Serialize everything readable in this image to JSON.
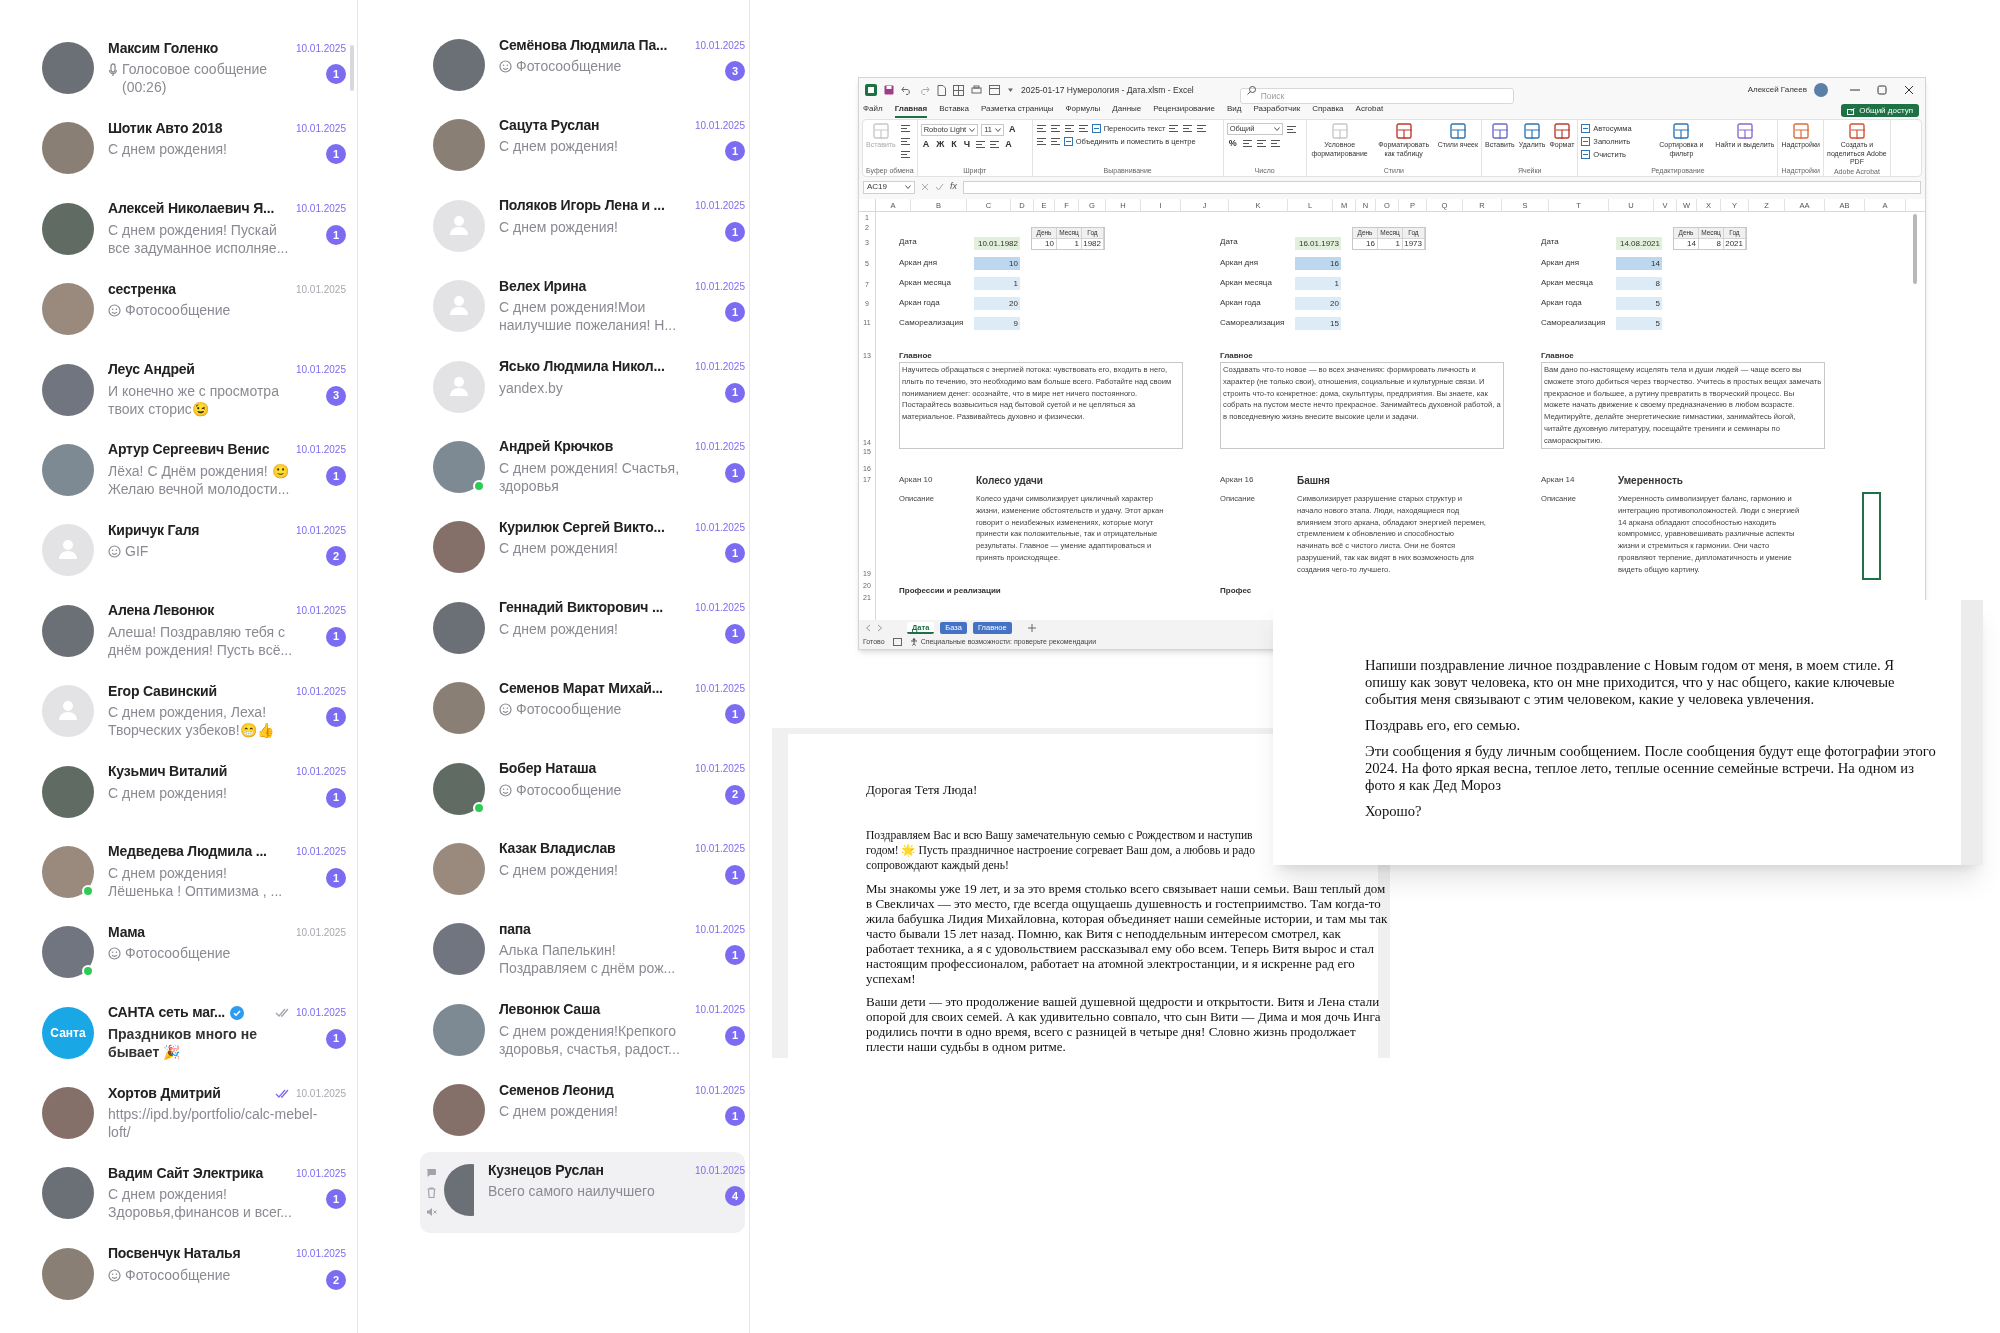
{
  "chats_left": [
    {
      "name": "Максим Голенко",
      "date": "10.01.2025",
      "preview": [
        "Голосовое сообщение",
        "(00:26)"
      ],
      "preview_icon": {
        "kind": "voice"
      },
      "unread": "1",
      "avatar": {
        "kind": "photo"
      },
      "online": false,
      "selected": false
    },
    {
      "name": "Шотик Авто 2018",
      "date": "10.01.2025",
      "preview": [
        "С днем рождения!"
      ],
      "unread": "1",
      "avatar": {
        "kind": "photo"
      },
      "online": false,
      "selected": false
    },
    {
      "name": "Алексей Николаевич Я...",
      "date": "10.01.2025",
      "preview": [
        "С днем рождения! Пускай",
        "все задуманное исполняе..."
      ],
      "unread": "1",
      "avatar": {
        "kind": "photo"
      },
      "online": false,
      "selected": false
    },
    {
      "name": "сестренка",
      "date": "10.01.2025",
      "preview": [
        "Фотосообщение"
      ],
      "preview_icon": {
        "kind": "photo"
      },
      "avatar": {
        "kind": "photo"
      },
      "online": false,
      "selected": false
    },
    {
      "name": "Леус Андрей",
      "date": "10.01.2025",
      "preview": [
        "И конечно же с просмотра",
        "твоих сторис😉"
      ],
      "unread": "3",
      "avatar": {
        "kind": "photo"
      },
      "online": false,
      "selected": false
    },
    {
      "name": "Артур Сергеевич Венис",
      "date": "10.01.2025",
      "preview": [
        "Лёха! С Днём рождения! 🙂",
        "Желаю вечной молодости..."
      ],
      "unread": "1",
      "avatar": {
        "kind": "photo"
      },
      "online": false,
      "selected": false
    },
    {
      "name": "Киричук Галя",
      "date": "10.01.2025",
      "preview": [
        "GIF"
      ],
      "preview_icon": {
        "kind": "photo"
      },
      "unread": "2",
      "avatar": {
        "kind": "default"
      },
      "online": false,
      "selected": false
    },
    {
      "name": "Алена Левонюк",
      "date": "10.01.2025",
      "preview": [
        "Алеша! Поздравляю тебя с",
        "днём рождения! Пусть всё..."
      ],
      "unread": "1",
      "avatar": {
        "kind": "photo"
      },
      "online": false,
      "selected": false
    },
    {
      "name": "Егор Савинский",
      "date": "10.01.2025",
      "preview": [
        "С днем рождения, Леха!",
        "Творческих узбеков!😁👍"
      ],
      "unread": "1",
      "avatar": {
        "kind": "default"
      },
      "online": false,
      "selected": false
    },
    {
      "name": "Кузьмич Виталий",
      "date": "10.01.2025",
      "preview": [
        "С днем рождения!"
      ],
      "unread": "1",
      "avatar": {
        "kind": "photo"
      },
      "online": false,
      "selected": false
    },
    {
      "name": "Медведева Людмила ...",
      "date": "10.01.2025",
      "preview": [
        "С днем рождения!",
        "Лёшенька ! Оптимизма , ..."
      ],
      "unread": "1",
      "avatar": {
        "kind": "photo"
      },
      "online": true,
      "selected": false
    },
    {
      "name": "Мама",
      "date": "10.01.2025",
      "preview": [
        "Фотосообщение"
      ],
      "preview_icon": {
        "kind": "photo"
      },
      "avatar": {
        "kind": "photo"
      },
      "online": true,
      "selected": false
    },
    {
      "name": "САНТА сеть маг...",
      "verified": true,
      "receipt": {
        "kind": "delivered"
      },
      "date": "10.01.2025",
      "preview": [
        "Праздников много не",
        "бывает 🎉"
      ],
      "bold": true,
      "unread": "1",
      "avatar": {
        "kind": "logo",
        "text": "Санта"
      },
      "online": false,
      "selected": false
    },
    {
      "name": "Хортов Дмитрий",
      "receipt": {
        "kind": "read"
      },
      "date": "10.01.2025",
      "preview": [
        "https://ipd.by/portfolio/calc-mebel-",
        "loft/"
      ],
      "avatar": {
        "kind": "photo"
      },
      "online": false,
      "selected": false
    },
    {
      "name": "Вадим Сайт Электрика",
      "date": "10.01.2025",
      "preview": [
        "С днем рождения!",
        "Здоровья,финансов и всег..."
      ],
      "unread": "1",
      "avatar": {
        "kind": "photo"
      },
      "online": false,
      "selected": false
    },
    {
      "name": "Посвенчук Наталья",
      "date": "10.01.2025",
      "preview": [
        "Фотосообщение"
      ],
      "preview_icon": {
        "kind": "photo"
      },
      "unread": "2",
      "avatar": {
        "kind": "photo"
      },
      "online": false,
      "selected": false
    }
  ],
  "chats_middle": [
    {
      "name": "Семёнова Людмила Па...",
      "date": "10.01.2025",
      "preview": [
        "Фотосообщение"
      ],
      "preview_icon": {
        "kind": "photo"
      },
      "unread": "3",
      "avatar": {
        "kind": "photo"
      },
      "online": false,
      "selected": false
    },
    {
      "name": "Сацута Руслан",
      "date": "10.01.2025",
      "preview": [
        "С днем рождения!"
      ],
      "unread": "1",
      "avatar": {
        "kind": "photo"
      },
      "online": false,
      "selected": false
    },
    {
      "name": "Поляков Игорь Лена и ...",
      "date": "10.01.2025",
      "preview": [
        "С днем рождения!"
      ],
      "unread": "1",
      "avatar": {
        "kind": "default"
      },
      "online": false,
      "selected": false
    },
    {
      "name": "Велех Ирина",
      "date": "10.01.2025",
      "preview": [
        "С днем рождения!Мои",
        "наилучшие пожелания! Н..."
      ],
      "unread": "1",
      "avatar": {
        "kind": "default"
      },
      "online": false,
      "selected": false
    },
    {
      "name": "Ясько Людмила Никол...",
      "date": "10.01.2025",
      "preview": [
        "yandex.by"
      ],
      "unread": "1",
      "avatar": {
        "kind": "default"
      },
      "online": false,
      "selected": false
    },
    {
      "name": "Андрей Крючков",
      "date": "10.01.2025",
      "preview": [
        "С днем рождения! Счастья,",
        "здоровья"
      ],
      "unread": "1",
      "avatar": {
        "kind": "photo"
      },
      "online": true,
      "selected": false
    },
    {
      "name": "Курилюк Сергей Викто...",
      "date": "10.01.2025",
      "preview": [
        "С днем рождения!"
      ],
      "unread": "1",
      "avatar": {
        "kind": "photo"
      },
      "online": false,
      "selected": false
    },
    {
      "name": "Геннадий Викторович ...",
      "date": "10.01.2025",
      "preview": [
        "С днем рождения!"
      ],
      "unread": "1",
      "avatar": {
        "kind": "photo"
      },
      "online": false,
      "selected": false
    },
    {
      "name": "Семенов Марат Михай...",
      "date": "10.01.2025",
      "preview": [
        "Фотосообщение"
      ],
      "preview_icon": {
        "kind": "photo"
      },
      "unread": "1",
      "avatar": {
        "kind": "photo"
      },
      "online": false,
      "selected": false
    },
    {
      "name": "Бобер Наташа",
      "date": "10.01.2025",
      "preview": [
        "Фотосообщение"
      ],
      "preview_icon": {
        "kind": "photo"
      },
      "unread": "2",
      "avatar": {
        "kind": "photo"
      },
      "online": true,
      "selected": false
    },
    {
      "name": "Казак Владислав",
      "date": "10.01.2025",
      "preview": [
        "С днем рождения!"
      ],
      "unread": "1",
      "avatar": {
        "kind": "photo"
      },
      "online": false,
      "selected": false
    },
    {
      "name": "папа",
      "date": "10.01.2025",
      "preview": [
        "Алька Папелькин!",
        "Поздравляем с днём рож..."
      ],
      "unread": "1",
      "avatar": {
        "kind": "photo"
      },
      "online": false,
      "selected": false
    },
    {
      "name": "Левонюк Саша",
      "date": "10.01.2025",
      "preview": [
        "С днем рождения!Крепкого",
        "здоровья, счастья, радост..."
      ],
      "unread": "1",
      "avatar": {
        "kind": "photo"
      },
      "online": false,
      "selected": false
    },
    {
      "name": "Семенов Леонид",
      "date": "10.01.2025",
      "preview": [
        "С днем рождения!"
      ],
      "unread": "1",
      "avatar": {
        "kind": "photo"
      },
      "online": false,
      "selected": false
    },
    {
      "name": "Кузнецов Руслан",
      "date": "10.01.2025",
      "preview": [
        "Всего самого наилучшего"
      ],
      "unread": "4",
      "avatar": {
        "kind": "photo"
      },
      "online": false,
      "selected": true
    }
  ],
  "excel": {
    "title": "2025-01-17 Нумерология - Дата.xlsm  -  Excel",
    "search_placeholder": "Поиск",
    "user": "Алексей Галеев",
    "menu": [
      {
        "label": "Файл",
        "selected": false
      },
      {
        "label": "Главная",
        "selected": true
      },
      {
        "label": "Вставка",
        "selected": false
      },
      {
        "label": "Разметка страницы",
        "selected": false
      },
      {
        "label": "Формулы",
        "selected": false
      },
      {
        "label": "Данные",
        "selected": false
      },
      {
        "label": "Рецензирование",
        "selected": false
      },
      {
        "label": "Вид",
        "selected": false
      },
      {
        "label": "Разработчик",
        "selected": false
      },
      {
        "label": "Справка",
        "selected": false
      },
      {
        "label": "Acrobat",
        "selected": false
      }
    ],
    "share_button": "Общий доступ",
    "ribbon": [
      {
        "label": "Буфер обмена",
        "controls": [
          {
            "kind": "big",
            "label": "Вставить",
            "disabled": true
          },
          {
            "kind": "icon"
          },
          {
            "kind": "icon"
          },
          {
            "kind": "icon"
          }
        ]
      },
      {
        "label": "Шрифт",
        "controls": [
          {
            "kind": "field",
            "value": "Roboto Light"
          },
          {
            "kind": "field",
            "value": "11"
          },
          {
            "kind": "glyph",
            "text": "A"
          },
          {
            "kind": "glyph",
            "text": "A"
          },
          {
            "kind": "glyph",
            "text": "Ж"
          },
          {
            "kind": "glyph",
            "text": "К"
          },
          {
            "kind": "glyph",
            "text": "Ч"
          },
          {
            "kind": "icon"
          },
          {
            "kind": "icon"
          },
          {
            "kind": "glyph",
            "text": "A"
          }
        ]
      },
      {
        "label": "Выравнивание",
        "controls": [
          {
            "kind": "icon"
          },
          {
            "kind": "icon"
          },
          {
            "kind": "icon"
          },
          {
            "kind": "icon"
          },
          {
            "kind": "small",
            "label": "Переносить текст"
          },
          {
            "kind": "icon"
          },
          {
            "kind": "icon"
          },
          {
            "kind": "icon"
          },
          {
            "kind": "icon"
          },
          {
            "kind": "icon"
          },
          {
            "kind": "small",
            "label": "Объединить и поместить в центре"
          }
        ]
      },
      {
        "label": "Число",
        "controls": [
          {
            "kind": "field",
            "value": "Общий"
          },
          {
            "kind": "icon"
          },
          {
            "kind": "glyph",
            "text": "%"
          },
          {
            "kind": "icon"
          },
          {
            "kind": "icon"
          },
          {
            "kind": "icon"
          }
        ]
      },
      {
        "label": "Стили",
        "controls": [
          {
            "kind": "big",
            "label": "Условное форматирование"
          },
          {
            "kind": "big",
            "label": "Форматировать как таблицу"
          },
          {
            "kind": "big",
            "label": "Стили ячеек"
          }
        ]
      },
      {
        "label": "Ячейки",
        "controls": [
          {
            "kind": "big",
            "label": "Вставить"
          },
          {
            "kind": "big",
            "label": "Удалить"
          },
          {
            "kind": "big",
            "label": "Формат"
          }
        ]
      },
      {
        "label": "Редактирование",
        "controls": [
          {
            "kind": "small",
            "label": "Автосумма"
          },
          {
            "kind": "small",
            "label": "Заполнить"
          },
          {
            "kind": "small",
            "label": "Очистить"
          },
          {
            "kind": "big",
            "label": "Сортировка и фильтр"
          },
          {
            "kind": "big",
            "label": "Найти и выделить"
          }
        ]
      },
      {
        "label": "Надстройки",
        "controls": [
          {
            "kind": "big",
            "label": "Надстройки"
          }
        ]
      },
      {
        "label": "Adobe Acrobat",
        "controls": [
          {
            "kind": "big",
            "label": "Создать и поделиться Adobe PDF"
          }
        ]
      }
    ],
    "name_box": "AC19",
    "fx": "fx",
    "columns": [
      "A",
      "B",
      "C",
      "D",
      "E",
      "F",
      "G",
      "H",
      "I",
      "J",
      "K",
      "L",
      "M",
      "N",
      "O",
      "P",
      "Q",
      "R",
      "S",
      "T",
      "U",
      "V",
      "W",
      "X",
      "Y",
      "Z",
      "AA",
      "AB",
      "A"
    ],
    "row_numbers": [
      "1",
      "2",
      "3",
      "5",
      "7",
      "9",
      "11",
      "13",
      "14",
      "15",
      "16",
      "17",
      "19",
      "20",
      "21"
    ],
    "blocks": [
      {
        "date_label": "Дата",
        "date": "10.01.1982",
        "dmy_headers": [
          "День",
          "Месяц",
          "Год"
        ],
        "dmy_values": [
          "10",
          "1",
          "1982"
        ],
        "arcana": [
          {
            "label": "Аркан дня",
            "value": "10"
          },
          {
            "label": "Аркан месяца",
            "value": "1"
          },
          {
            "label": "Аркан года",
            "value": "20"
          },
          {
            "label": "Самореализация",
            "value": "9"
          }
        ],
        "main_title": "Главное",
        "main_text": "Научитесь обращаться с энергией потока: чувствовать его, входить в него, плыть по течению, это необходимо вам больше всего. Работайте над своим пониманием денег: осознайте, что в мире нет ничего постоянного. Постарайтесь возвыситься над бытовой суетой и не цепляться за материальное. Развивайтесь духовно и физически.",
        "arcan_label": "Аркан 10",
        "arcan_name": "Колесо удачи",
        "desc_label": "Описание",
        "desc_text": "Колесо удачи символизирует цикличный характер жизни, изменение обстоятельств и удачу. Этот аркан говорит о неизбежных изменениях, которые могут принести как положительные, так и отрицательные результаты. Главное — умение адаптироваться и принять происходящее.",
        "professions": "Профессии и реализации"
      },
      {
        "date_label": "Дата",
        "date": "16.01.1973",
        "dmy_headers": [
          "День",
          "Месяц",
          "Год"
        ],
        "dmy_values": [
          "16",
          "1",
          "1973"
        ],
        "arcana": [
          {
            "label": "Аркан дня",
            "value": "16"
          },
          {
            "label": "Аркан месяца",
            "value": "1"
          },
          {
            "label": "Аркан года",
            "value": "20"
          },
          {
            "label": "Самореализация",
            "value": "15"
          }
        ],
        "main_title": "Главное",
        "main_text": "Создавать что-то новое — во всех значениях: формировать личность и характер (не только свои), отношения, социальные и культурные связи. И строить что-то конкретное: дома, скульптуры, предприятия. Вы знаете, как собрать на пустом месте нечто прекрасное. Занимайтесь духовной работой, а в повседневную жизнь внесите высокие цели и задачи.",
        "arcan_label": "Аркан 16",
        "arcan_name": "Башня",
        "desc_label": "Описание",
        "desc_text": "Символизирует разрушение старых структур и начало нового этапа. Люди, находящиеся под влиянием этого аркана, обладают энергией перемен, стремлением к обновлению и способностью начинать всё с чистого листа. Они не боятся разрушений, так как видят в них возможность для создания чего-то лучшего.",
        "professions": "Профес"
      },
      {
        "date_label": "Дата",
        "date": "14.08.2021",
        "dmy_headers": [
          "День",
          "Месяц",
          "Год"
        ],
        "dmy_values": [
          "14",
          "8",
          "2021"
        ],
        "arcana": [
          {
            "label": "Аркан дня",
            "value": "14"
          },
          {
            "label": "Аркан месяца",
            "value": "8"
          },
          {
            "label": "Аркан года",
            "value": "5"
          },
          {
            "label": "Самореализация",
            "value": "5"
          }
        ],
        "main_title": "Главное",
        "main_text": "Вам дано по-настоящему исцелять тела и души людей — чаще всего вы сможете этого добиться через творчество. Учитесь в простых вещах замечать прекрасное и большее, а рутину превратить в творческий процесс. Вы можете начать движение к своему предназначению в любом возрасте. Медитируйте, делайте энергетические гимнастики, занимайтесь йогой, читайте духовную литературу, посещайте тренинги и семинары по самораскрытию.",
        "arcan_label": "Аркан 14",
        "arcan_name": "Умеренность",
        "desc_label": "Описание",
        "desc_text": "Умеренность символизирует баланс, гармонию и интеграцию противоположностей. Люди с энергией 14 аркана обладают способностью находить компромисс, уравновешивать различные аспекты жизни и стремиться к гармонии. Они часто проявляют терпение, дипломатичность и умение видеть общую картину."
      }
    ],
    "sheet_tabs": [
      {
        "label": "Дата",
        "selected": true
      },
      {
        "label": "База",
        "selected": false,
        "color": "#4472c4"
      },
      {
        "label": "Главное",
        "selected": false,
        "color": "#4472c4"
      }
    ],
    "status": "Готово",
    "accessibility": "Специальные возможности: проверьте рекомендации"
  },
  "letter_doc": {
    "greeting": "Дорогая Тетя Люда!",
    "paragraphs": [
      [
        "Поздравляем Вас и всю Вашу замечательную семью с Рождеством и наступив",
        "годом! 🌟 Пусть праздничное настроение согревает Ваш дом, а любовь и радо",
        "сопровождают каждый день!"
      ],
      [
        "Мы знакомы уже 19 лет, и за это время столько всего связывает наши семьи. Ваш теплый дом",
        "в Свекличах — это место, где всегда ощущаешь душевность и гостеприимство. Там когда-то",
        "жила бабушка Лидия Михайловна, которая объединяет наши семейные истории, и там мы так",
        "часто бывали 15 лет назад. Помню, как Витя с неподдельным интересом смотрел, как",
        "работает техника, а я с удовольствием рассказывал ему обо всем. Теперь Витя вырос и стал",
        "настоящим профессионалом, работает на атомной электростанции, и я искренне рад его",
        "успехам!"
      ],
      [
        "Ваши дети — это продолжение вашей душевной щедрости и открытости. Витя и Лена стали",
        "опорой для своих семей. А как удивительно совпало, что сын Вити — Дима и моя дочь Инга",
        "родились почти в одно время, всего с разницей в четыре дня! Словно жизнь продолжает",
        "плести наши судьбы в одном ритме."
      ]
    ]
  },
  "prompt_doc": {
    "paragraphs": [
      "Напиши поздравление личное поздравление с Новым годом от меня, в моем стиле. Я опишу как зовут человека, кто он мне приходится, что у нас общего, какие ключевые события меня связывают с этим человеком, какие у человека увлечения.",
      "Поздравь его, его семью.",
      "Эти сообщения я буду личным сообщением. После сообщения будут еще фотографии этого 2024. На фото яркая весна, теплое лето, теплые осенние семейные встречи. На одном из фото я как Дед Мороз",
      "Хорошо?"
    ]
  }
}
